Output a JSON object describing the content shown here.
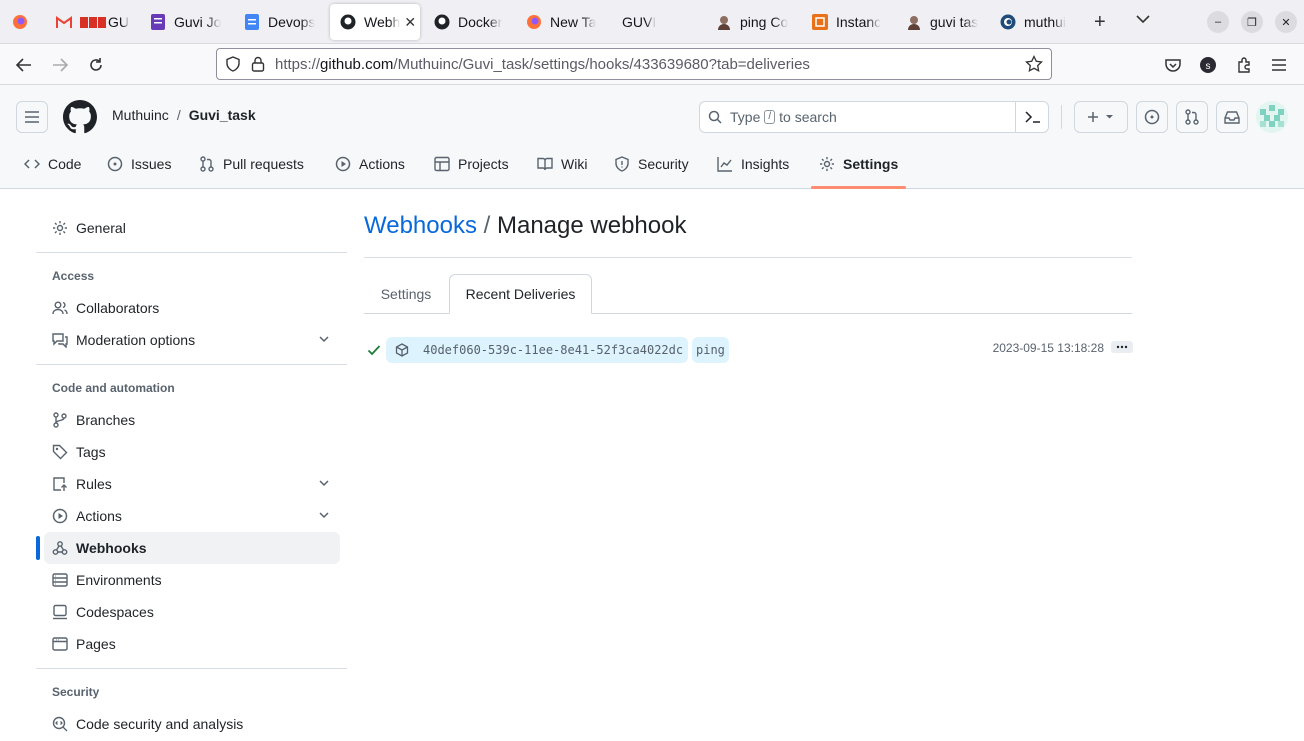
{
  "browser": {
    "tabs": [
      {
        "label": "",
        "icon": "firefox-icon"
      },
      {
        "label": "GU",
        "icon": "gmail-icon"
      },
      {
        "label": "Guvi Jo",
        "icon": "forms-icon"
      },
      {
        "label": "Devops",
        "icon": "docs-icon"
      },
      {
        "label": "Webh",
        "icon": "github-icon",
        "active": true
      },
      {
        "label": "Docker",
        "icon": "github-icon"
      },
      {
        "label": "New Ta",
        "icon": "firefox-icon"
      },
      {
        "label": "GUVI",
        "icon": ""
      },
      {
        "label": "ping Co",
        "icon": "avatar-icon"
      },
      {
        "label": "Instanc",
        "icon": "aws-icon"
      },
      {
        "label": "guvi tas",
        "icon": "avatar-icon"
      },
      {
        "label": "muthui",
        "icon": "edge-icon"
      }
    ],
    "url_prefix": "https://",
    "url_host": "github.com",
    "url_path": "/Muthuinc/Guvi_task/settings/hooks/433639680?tab=deliveries"
  },
  "github": {
    "owner": "Muthuinc",
    "separator": "/",
    "repo": "Guvi_task",
    "search_prefix": "Type",
    "search_key": "/",
    "search_suffix": "to search",
    "repo_nav": [
      {
        "label": "Code",
        "icon": "code-icon"
      },
      {
        "label": "Issues",
        "icon": "issue-icon"
      },
      {
        "label": "Pull requests",
        "icon": "pull-request-icon"
      },
      {
        "label": "Actions",
        "icon": "play-icon"
      },
      {
        "label": "Projects",
        "icon": "table-icon"
      },
      {
        "label": "Wiki",
        "icon": "book-icon"
      },
      {
        "label": "Security",
        "icon": "shield-icon"
      },
      {
        "label": "Insights",
        "icon": "graph-icon"
      },
      {
        "label": "Settings",
        "icon": "gear-icon",
        "active": true
      }
    ],
    "accent_color": "#fd8c73"
  },
  "sidebar": {
    "general": "General",
    "access_heading": "Access",
    "collaborators": "Collaborators",
    "moderation": "Moderation options",
    "code_heading": "Code and automation",
    "branches": "Branches",
    "tags": "Tags",
    "rules": "Rules",
    "actions": "Actions",
    "webhooks": "Webhooks",
    "environments": "Environments",
    "codespaces": "Codespaces",
    "pages": "Pages",
    "security_heading": "Security",
    "code_security": "Code security and analysis"
  },
  "main": {
    "breadcrumb_link": "Webhooks",
    "breadcrumb_sep": "/",
    "title": "Manage webhook",
    "tabs": {
      "settings": "Settings",
      "recent": "Recent Deliveries"
    },
    "delivery": {
      "guid": "40def060-539c-11ee-8e41-52f3ca4022dc",
      "event": "ping",
      "timestamp": "2023-09-15 13:18:28",
      "status": "success"
    }
  }
}
